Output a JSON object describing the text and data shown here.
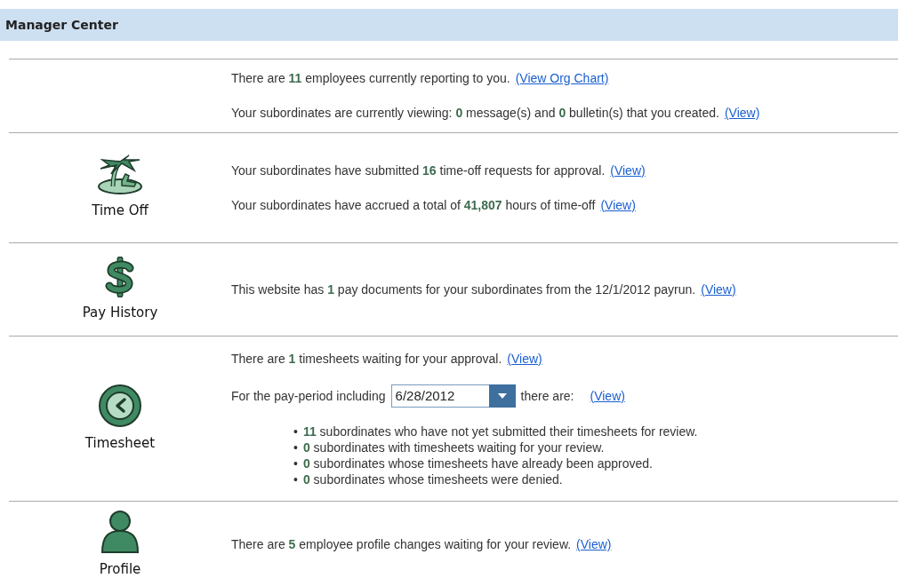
{
  "header": {
    "title": "Manager Center"
  },
  "sections": [
    {
      "lines": [
        {
          "kind": "text",
          "text": "There are **11**  employees  currently reporting to you.",
          "link": "(View Org Chart)"
        },
        {
          "kind": "text",
          "text": "Your subordinates are currently viewing: **0** message(s) and **0** bulletin(s) that you created.",
          "link": "(View)"
        }
      ]
    },
    {
      "label": "Time Off",
      "lines": [
        {
          "kind": "text",
          "text": "Your subordinates have submitted **16** time-off requests for approval.",
          "link": "(View)"
        },
        {
          "kind": "text",
          "text": "Your subordinates have accrued a total of **41,807** hours of time-off",
          "link": "(View)"
        }
      ]
    },
    {
      "label": "Pay History",
      "lines": [
        {
          "kind": "text",
          "text": "This website has **1** pay documents for your subordinates from the 12/1/2012 payrun.",
          "link": "(View)"
        }
      ]
    },
    {
      "label": "Timesheet",
      "lines": [
        {
          "kind": "text",
          "text": "There are **1** timesheets waiting for your approval.",
          "link": "(View)"
        },
        {
          "kind": "date",
          "before": "For the pay-period including",
          "value": "6/28/2012",
          "after": "there are:",
          "link": "(View)"
        },
        {
          "kind": "bullets",
          "items": [
            {
              "bullet": "•",
              "text": "**11** subordinates who have not yet submitted their timesheets for review."
            },
            {
              "bullet": "•",
              "text": "**0** subordinates with timesheets waiting for your review."
            },
            {
              "bullet": "•",
              "text": "**0** subordinates whose timesheets have already been approved."
            },
            {
              "bullet": "•",
              "text": "**0** subordinates whose timesheets were denied."
            }
          ]
        }
      ]
    },
    {
      "label": "Profile",
      "lines": [
        {
          "kind": "text",
          "text": "There are **5** employee profile changes waiting for your review.",
          "link": "(View)"
        }
      ]
    }
  ]
}
